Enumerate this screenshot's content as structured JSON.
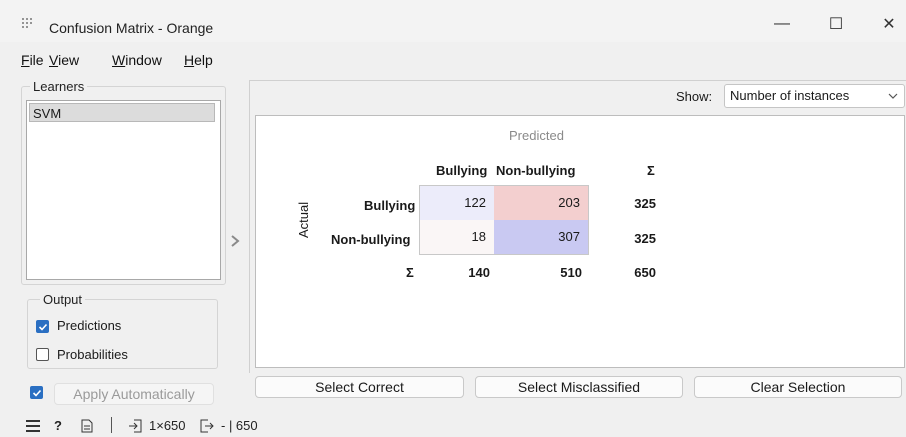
{
  "window": {
    "title": "Confusion Matrix - Orange",
    "minimize_glyph": "—",
    "maximize_glyph": "☐",
    "close_glyph": "✕"
  },
  "menu": [
    {
      "underline": "F",
      "rest": "ile"
    },
    {
      "underline": "V",
      "rest": "iew"
    },
    {
      "underline": "W",
      "rest": "indow"
    },
    {
      "underline": "H",
      "rest": "elp"
    }
  ],
  "learners": {
    "title": "Learners",
    "items": [
      "SVM"
    ]
  },
  "output": {
    "title": "Output",
    "predictions": {
      "label": "Predictions",
      "checked": true
    },
    "probabilities": {
      "label": "Probabilities",
      "checked": false
    }
  },
  "apply": {
    "label": "Apply Automatically",
    "checked": true
  },
  "show": {
    "label": "Show:",
    "value": "Number of instances"
  },
  "matrix": {
    "predicted_label": "Predicted",
    "actual_label": "Actual",
    "sigma": "Σ",
    "columns": [
      "Bullying",
      "Non-bullying"
    ],
    "rows": [
      {
        "label": "Bullying",
        "values": [
          "122",
          "203"
        ],
        "total": "325"
      },
      {
        "label": "Non-bullying",
        "values": [
          "18",
          "307"
        ],
        "total": "325"
      }
    ],
    "column_totals": [
      "140",
      "510"
    ],
    "grand_total": "650",
    "cell_colors": [
      [
        "#ececfa",
        "#f3cfcf"
      ],
      [
        "#faf6f6",
        "#c9c9f2"
      ]
    ]
  },
  "buttons": {
    "select_correct": "Select Correct",
    "select_misclassified": "Select Misclassified",
    "clear_selection": "Clear Selection"
  },
  "status": {
    "input_summary": "1×650",
    "output_summary": "- | 650"
  },
  "colors": {
    "accent": "#2a6fc2"
  }
}
